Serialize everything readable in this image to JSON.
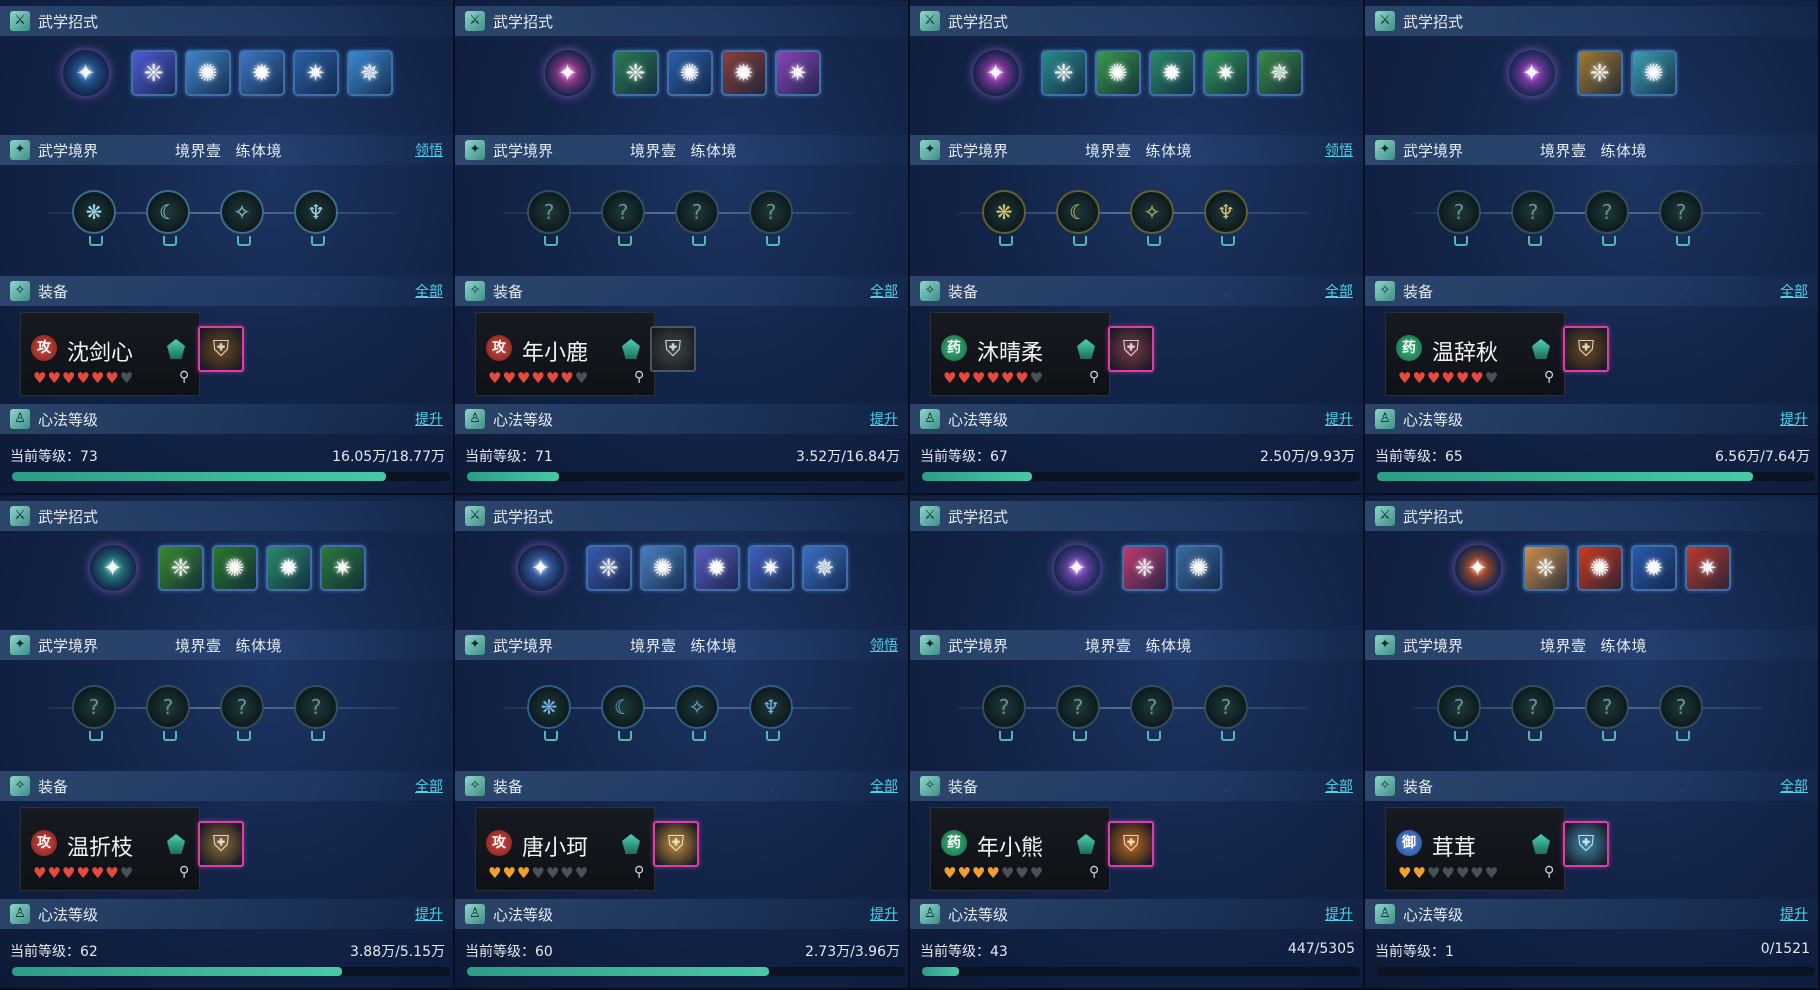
{
  "labels": {
    "skills": "武学招式",
    "realm": "武学境界",
    "realm_level": "境界壹",
    "realm_stage": "练体境",
    "comprehend": "领悟",
    "equip": "装备",
    "all": "全部",
    "heart": "心法等级",
    "upgrade": "提升",
    "current_level": "当前等级："
  },
  "panels": [
    {
      "name": "沈剑心",
      "role": "攻",
      "role_type": "atk",
      "hearts": [
        "r",
        "r",
        "r",
        "r",
        "r",
        "r",
        "e"
      ],
      "level": "73",
      "exp": "16.05万/18.77万",
      "progress": 0.855,
      "realm_link": true,
      "skills": [
        "#2b6fb8",
        "#4f5bd6",
        "#3e86c9",
        "#3c77c2",
        "#2a60a8",
        "#3a8ad4"
      ],
      "main_color": "#4a7fd1",
      "nodes": "lit",
      "item": "gold",
      "item_color": "#6b4a1f"
    },
    {
      "name": "年小鹿",
      "role": "攻",
      "role_type": "atk",
      "hearts": [
        "r",
        "r",
        "r",
        "r",
        "r",
        "r",
        "e"
      ],
      "level": "71",
      "exp": "3.52万/16.84万",
      "progress": 0.209,
      "realm_link": false,
      "skills": [
        "#d43fa8",
        "#2c7a54",
        "#2b5fa8",
        "#8a3f3a",
        "#8b45b8"
      ],
      "main_color": "#d43fa8",
      "nodes": "dark",
      "item": "plain",
      "item_color": "#3c4a48"
    },
    {
      "name": "沐晴柔",
      "role": "药",
      "role_type": "med",
      "hearts": [
        "r",
        "r",
        "r",
        "r",
        "r",
        "r",
        "e"
      ],
      "level": "67",
      "exp": "2.50万/9.93万",
      "progress": 0.252,
      "realm_link": true,
      "skills": [
        "#c040c8",
        "#2a8a8a",
        "#3a9a4a",
        "#2a8a6a",
        "#2f9a5a",
        "#3a8a44"
      ],
      "main_color": "#c040c8",
      "nodes": "gold",
      "item": "gold",
      "item_color": "#7a3a4a"
    },
    {
      "name": "温辞秋",
      "role": "药",
      "role_type": "med",
      "hearts": [
        "r",
        "r",
        "r",
        "r",
        "r",
        "r",
        "e"
      ],
      "level": "65",
      "exp": "6.56万/7.64万",
      "progress": 0.859,
      "realm_link": false,
      "skills": [
        "#b040d0",
        "#a07a30",
        "#3aa0b0"
      ],
      "main_color": "#b040d0",
      "nodes": "dark",
      "item": "gold",
      "item_color": "#6b4a1f"
    },
    {
      "name": "温折枝",
      "role": "攻",
      "role_type": "atk",
      "hearts": [
        "r",
        "r",
        "r",
        "r",
        "r",
        "r",
        "e"
      ],
      "level": "62",
      "exp": "3.88万/5.15万",
      "progress": 0.753,
      "realm_link": false,
      "skills": [
        "#2aa090",
        "#3a8a2a",
        "#2a7a2a",
        "#2a8a6a",
        "#2a7a3a"
      ],
      "main_color": "#2aa090",
      "nodes": "dark",
      "item": "gold",
      "item_color": "#8a6a3a"
    },
    {
      "name": "唐小珂",
      "role": "攻",
      "role_type": "atk",
      "hearts": [
        "o",
        "o",
        "o",
        "e",
        "e",
        "e",
        "e"
      ],
      "level": "60",
      "exp": "2.73万/3.96万",
      "progress": 0.689,
      "realm_link": true,
      "skills": [
        "#4a7ad0",
        "#3a5ab0",
        "#4a80c0",
        "#5a5ac0",
        "#4060c0",
        "#3a70c8"
      ],
      "main_color": "#5a8ad0",
      "nodes": "blue",
      "item": "gold",
      "item_color": "#c09040"
    },
    {
      "name": "年小熊",
      "role": "药",
      "role_type": "med",
      "hearts": [
        "o",
        "o",
        "o",
        "o",
        "e",
        "e",
        "e"
      ],
      "level": "43",
      "exp": "447/5305",
      "progress": 0.084,
      "realm_link": false,
      "skills": [
        "#9a50d8",
        "#c03a70",
        "#3a6aa0"
      ],
      "main_color": "#9a50d8",
      "nodes": "dark",
      "item": "gold",
      "item_color": "#c06a20"
    },
    {
      "name": "茸茸",
      "role": "御",
      "role_type": "def",
      "hearts": [
        "o",
        "o",
        "e",
        "e",
        "e",
        "e",
        "e"
      ],
      "level": "1",
      "exp": "0/1521",
      "progress": 0.0,
      "realm_link": false,
      "skills": [
        "#e05a20",
        "#d0904a",
        "#d03a1a",
        "#2a5ab0",
        "#c03a2a"
      ],
      "main_color": "#e05a20",
      "nodes": "dark",
      "item": "gold",
      "item_color": "#3a8ab0"
    }
  ]
}
